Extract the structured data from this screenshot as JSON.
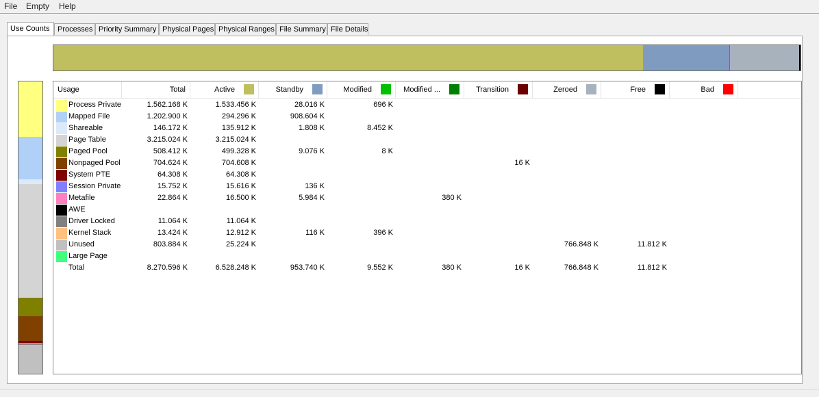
{
  "menu": {
    "file": "File",
    "empty": "Empty",
    "help": "Help"
  },
  "tabs": [
    "Use Counts",
    "Processes",
    "Priority Summary",
    "Physical Pages",
    "Physical Ranges",
    "File Summary",
    "File Details"
  ],
  "colors": {
    "active": "#bfbf60",
    "standby": "#7f9cc0",
    "modified": "#00c000",
    "modified_no_write": "#008000",
    "transition": "#6a0000",
    "zeroed": "#a8b2bd",
    "free": "#000000",
    "bad": "#ff0000"
  },
  "columns": {
    "usage": "Usage",
    "total": "Total",
    "active": "Active",
    "standby": "Standby",
    "modified": "Modified",
    "modified_no_write": "Modified ...",
    "transition": "Transition",
    "zeroed": "Zeroed",
    "free": "Free",
    "bad": "Bad"
  },
  "rows": [
    {
      "name": "Process Private",
      "color": "#ffff80",
      "total": "1.562.168 K",
      "active": "1.533.456 K",
      "standby": "28.016 K",
      "modified": "696 K",
      "modified_no_write": "",
      "transition": "",
      "zeroed": "",
      "free": "",
      "bad": ""
    },
    {
      "name": "Mapped File",
      "color": "#b0d0f8",
      "total": "1.202.900 K",
      "active": "294.296 K",
      "standby": "908.604 K",
      "modified": "",
      "modified_no_write": "",
      "transition": "",
      "zeroed": "",
      "free": "",
      "bad": ""
    },
    {
      "name": "Shareable",
      "color": "#dbeaf8",
      "total": "146.172 K",
      "active": "135.912 K",
      "standby": "1.808 K",
      "modified": "8.452 K",
      "modified_no_write": "",
      "transition": "",
      "zeroed": "",
      "free": "",
      "bad": ""
    },
    {
      "name": "Page Table",
      "color": "#d4d4d4",
      "total": "3.215.024 K",
      "active": "3.215.024 K",
      "standby": "",
      "modified": "",
      "modified_no_write": "",
      "transition": "",
      "zeroed": "",
      "free": "",
      "bad": ""
    },
    {
      "name": "Paged Pool",
      "color": "#808000",
      "total": "508.412 K",
      "active": "499.328 K",
      "standby": "9.076 K",
      "modified": "8 K",
      "modified_no_write": "",
      "transition": "",
      "zeroed": "",
      "free": "",
      "bad": ""
    },
    {
      "name": "Nonpaged Pool",
      "color": "#804000",
      "total": "704.624 K",
      "active": "704.608 K",
      "standby": "",
      "modified": "",
      "modified_no_write": "",
      "transition": "16 K",
      "zeroed": "",
      "free": "",
      "bad": ""
    },
    {
      "name": "System PTE",
      "color": "#800000",
      "total": "64.308 K",
      "active": "64.308 K",
      "standby": "",
      "modified": "",
      "modified_no_write": "",
      "transition": "",
      "zeroed": "",
      "free": "",
      "bad": ""
    },
    {
      "name": "Session Private",
      "color": "#8080ff",
      "total": "15.752 K",
      "active": "15.616 K",
      "standby": "136 K",
      "modified": "",
      "modified_no_write": "",
      "transition": "",
      "zeroed": "",
      "free": "",
      "bad": ""
    },
    {
      "name": "Metafile",
      "color": "#ff80c0",
      "total": "22.864 K",
      "active": "16.500 K",
      "standby": "5.984 K",
      "modified": "",
      "modified_no_write": "380 K",
      "transition": "",
      "zeroed": "",
      "free": "",
      "bad": ""
    },
    {
      "name": "AWE",
      "color": "#000000",
      "total": "",
      "active": "",
      "standby": "",
      "modified": "",
      "modified_no_write": "",
      "transition": "",
      "zeroed": "",
      "free": "",
      "bad": ""
    },
    {
      "name": "Driver Locked",
      "color": "#808080",
      "total": "11.064 K",
      "active": "11.064 K",
      "standby": "",
      "modified": "",
      "modified_no_write": "",
      "transition": "",
      "zeroed": "",
      "free": "",
      "bad": ""
    },
    {
      "name": "Kernel Stack",
      "color": "#ffc080",
      "total": "13.424 K",
      "active": "12.912 K",
      "standby": "116 K",
      "modified": "396 K",
      "modified_no_write": "",
      "transition": "",
      "zeroed": "",
      "free": "",
      "bad": ""
    },
    {
      "name": "Unused",
      "color": "#c0c0c0",
      "total": "803.884 K",
      "active": "25.224 K",
      "standby": "",
      "modified": "",
      "modified_no_write": "",
      "transition": "",
      "zeroed": "766.848 K",
      "free": "11.812 K",
      "bad": ""
    },
    {
      "name": "Large Page",
      "color": "#40ff80",
      "total": "",
      "active": "",
      "standby": "",
      "modified": "",
      "modified_no_write": "",
      "transition": "",
      "zeroed": "",
      "free": "",
      "bad": ""
    },
    {
      "name": "Total",
      "color": "",
      "total": "8.270.596 K",
      "active": "6.528.248 K",
      "standby": "953.740 K",
      "modified": "9.552 K",
      "modified_no_write": "380 K",
      "transition": "16 K",
      "zeroed": "766.848 K",
      "free": "11.812 K",
      "bad": ""
    }
  ],
  "state_bar": [
    {
      "state": "active",
      "value": 6528248
    },
    {
      "state": "standby",
      "value": 953740
    },
    {
      "state": "modified",
      "value": 9552
    },
    {
      "state": "modified_no_write",
      "value": 380
    },
    {
      "state": "transition",
      "value": 16
    },
    {
      "state": "zeroed",
      "value": 766848
    },
    {
      "state": "free",
      "value": 11812
    }
  ]
}
